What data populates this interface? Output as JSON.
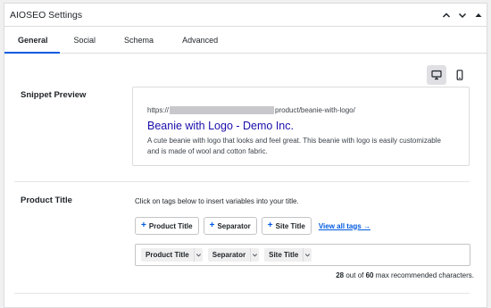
{
  "panel": {
    "title": "AIOSEO Settings"
  },
  "tabs": [
    {
      "label": "General",
      "active": true
    },
    {
      "label": "Social",
      "active": false
    },
    {
      "label": "Schema",
      "active": false
    },
    {
      "label": "Advanced",
      "active": false
    }
  ],
  "snippet_preview": {
    "label": "Snippet Preview",
    "url_prefix": "https://",
    "url_suffix": "product/beanie-with-logo/",
    "title": "Beanie with Logo - Demo Inc.",
    "description": "A cute beanie with logo that looks and feel great. This beanie with logo is easily customizable and is made of wool and cotton fabric."
  },
  "device_toggle": {
    "desktop_icon": "desktop-icon",
    "mobile_icon": "mobile-icon",
    "active": "desktop"
  },
  "product_title": {
    "label": "Product Title",
    "help": "Click on tags below to insert variables into your title.",
    "tag_buttons": [
      "Product Title",
      "Separator",
      "Site Title"
    ],
    "view_all": "View all tags →",
    "chips": [
      "Product Title",
      "Separator",
      "Site Title"
    ],
    "count_value": "28",
    "count_mid": " out of ",
    "count_max": "60",
    "count_suffix": " max recommended characters."
  },
  "colors": {
    "accent": "#005ae0",
    "link_title": "#1a0dab",
    "border": "#dcdcde"
  }
}
